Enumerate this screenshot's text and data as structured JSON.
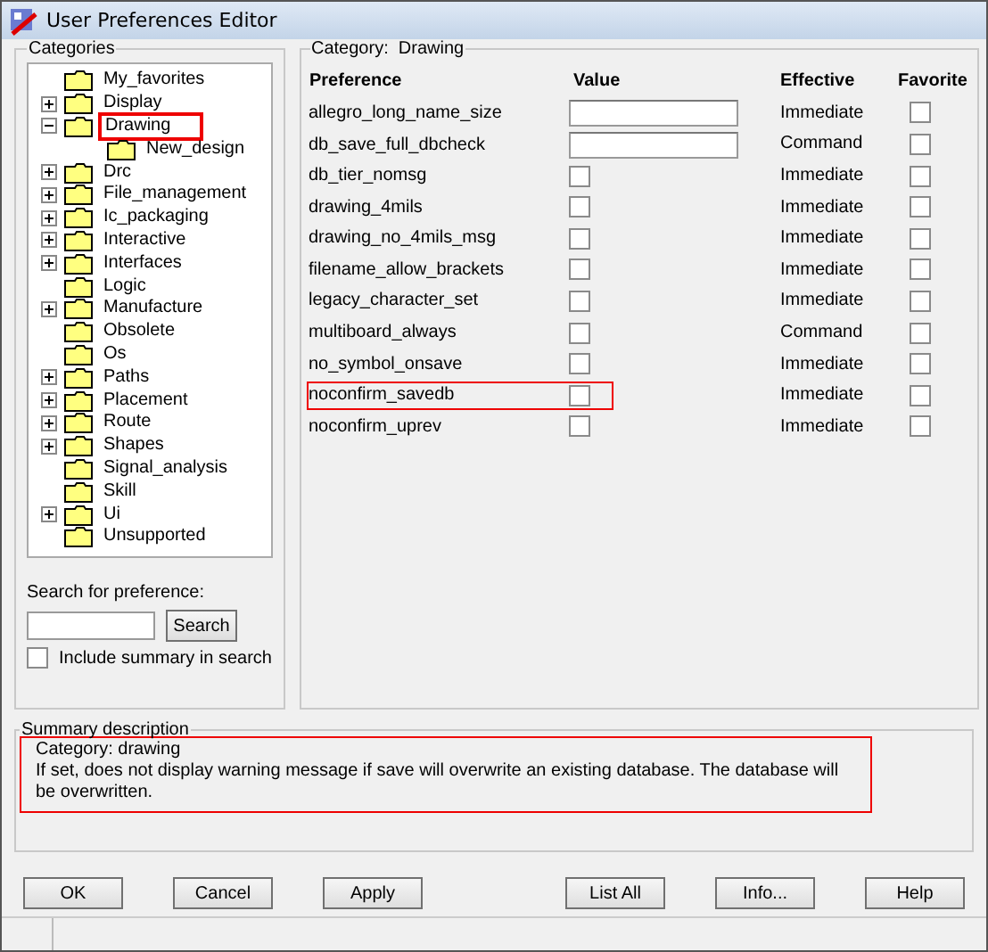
{
  "window": {
    "title": "User Preferences Editor"
  },
  "categories": {
    "title": "Categories",
    "items": [
      {
        "label": "My_favorites",
        "kind": "leaf",
        "highlighted": false
      },
      {
        "label": "Display",
        "kind": "group",
        "expanded": false,
        "highlighted": false
      },
      {
        "label": "Drawing",
        "kind": "group",
        "expanded": true,
        "highlighted": true,
        "children": [
          {
            "label": "New_design",
            "kind": "leaf",
            "highlighted": false
          }
        ]
      },
      {
        "label": "Drc",
        "kind": "group",
        "expanded": false,
        "highlighted": false
      },
      {
        "label": "File_management",
        "kind": "group",
        "expanded": false,
        "highlighted": false
      },
      {
        "label": "Ic_packaging",
        "kind": "group",
        "expanded": false,
        "highlighted": false
      },
      {
        "label": "Interactive",
        "kind": "group",
        "expanded": false,
        "highlighted": false
      },
      {
        "label": "Interfaces",
        "kind": "group",
        "expanded": false,
        "highlighted": false
      },
      {
        "label": "Logic",
        "kind": "leaf",
        "highlighted": false
      },
      {
        "label": "Manufacture",
        "kind": "group",
        "expanded": false,
        "highlighted": false
      },
      {
        "label": "Obsolete",
        "kind": "leaf",
        "highlighted": false
      },
      {
        "label": "Os",
        "kind": "leaf",
        "highlighted": false
      },
      {
        "label": "Paths",
        "kind": "group",
        "expanded": false,
        "highlighted": false
      },
      {
        "label": "Placement",
        "kind": "group",
        "expanded": false,
        "highlighted": false
      },
      {
        "label": "Route",
        "kind": "group",
        "expanded": false,
        "highlighted": false
      },
      {
        "label": "Shapes",
        "kind": "group",
        "expanded": false,
        "highlighted": false
      },
      {
        "label": "Signal_analysis",
        "kind": "leaf",
        "highlighted": false
      },
      {
        "label": "Skill",
        "kind": "leaf",
        "highlighted": false
      },
      {
        "label": "Ui",
        "kind": "group",
        "expanded": false,
        "highlighted": false
      },
      {
        "label": "Unsupported",
        "kind": "leaf",
        "highlighted": false
      }
    ]
  },
  "search": {
    "label": "Search for preference:",
    "button": "Search",
    "include_summary": {
      "label": "Include summary in search",
      "checked": false
    }
  },
  "preferences": {
    "category_label": "Category:",
    "category": "Drawing",
    "columns": [
      "Preference",
      "Value",
      "Effective",
      "Favorite"
    ],
    "rows": [
      {
        "name": "allegro_long_name_size",
        "kind": "text",
        "effective": "Immediate",
        "favorite": false,
        "highlighted": false
      },
      {
        "name": "db_save_full_dbcheck",
        "kind": "text",
        "effective": "Command",
        "favorite": false,
        "highlighted": false
      },
      {
        "name": "db_tier_nomsg",
        "kind": "checkbox",
        "checked": false,
        "effective": "Immediate",
        "favorite": false,
        "highlighted": false
      },
      {
        "name": "drawing_4mils",
        "kind": "checkbox",
        "checked": false,
        "effective": "Immediate",
        "favorite": false,
        "highlighted": false
      },
      {
        "name": "drawing_no_4mils_msg",
        "kind": "checkbox",
        "checked": false,
        "effective": "Immediate",
        "favorite": false,
        "highlighted": false
      },
      {
        "name": "filename_allow_brackets",
        "kind": "checkbox",
        "checked": false,
        "effective": "Immediate",
        "favorite": false,
        "highlighted": false
      },
      {
        "name": "legacy_character_set",
        "kind": "checkbox",
        "checked": false,
        "effective": "Immediate",
        "favorite": false,
        "highlighted": false
      },
      {
        "name": "multiboard_always",
        "kind": "checkbox",
        "checked": false,
        "effective": "Command",
        "favorite": false,
        "highlighted": false
      },
      {
        "name": "no_symbol_onsave",
        "kind": "checkbox",
        "checked": false,
        "effective": "Immediate",
        "favorite": false,
        "highlighted": false
      },
      {
        "name": "noconfirm_savedb",
        "kind": "checkbox",
        "checked": false,
        "effective": "Immediate",
        "favorite": false,
        "highlighted": true
      },
      {
        "name": "noconfirm_uprev",
        "kind": "checkbox",
        "checked": false,
        "effective": "Immediate",
        "favorite": false,
        "highlighted": false
      }
    ]
  },
  "summary": {
    "title": "Summary description",
    "highlighted": true,
    "lines": [
      "Category: drawing",
      "If set, does not display warning message if save will overwrite an existing database. The database will be overwritten."
    ]
  },
  "buttons": [
    "OK",
    "Cancel",
    "Apply",
    "List All",
    "Info...",
    "Help"
  ]
}
